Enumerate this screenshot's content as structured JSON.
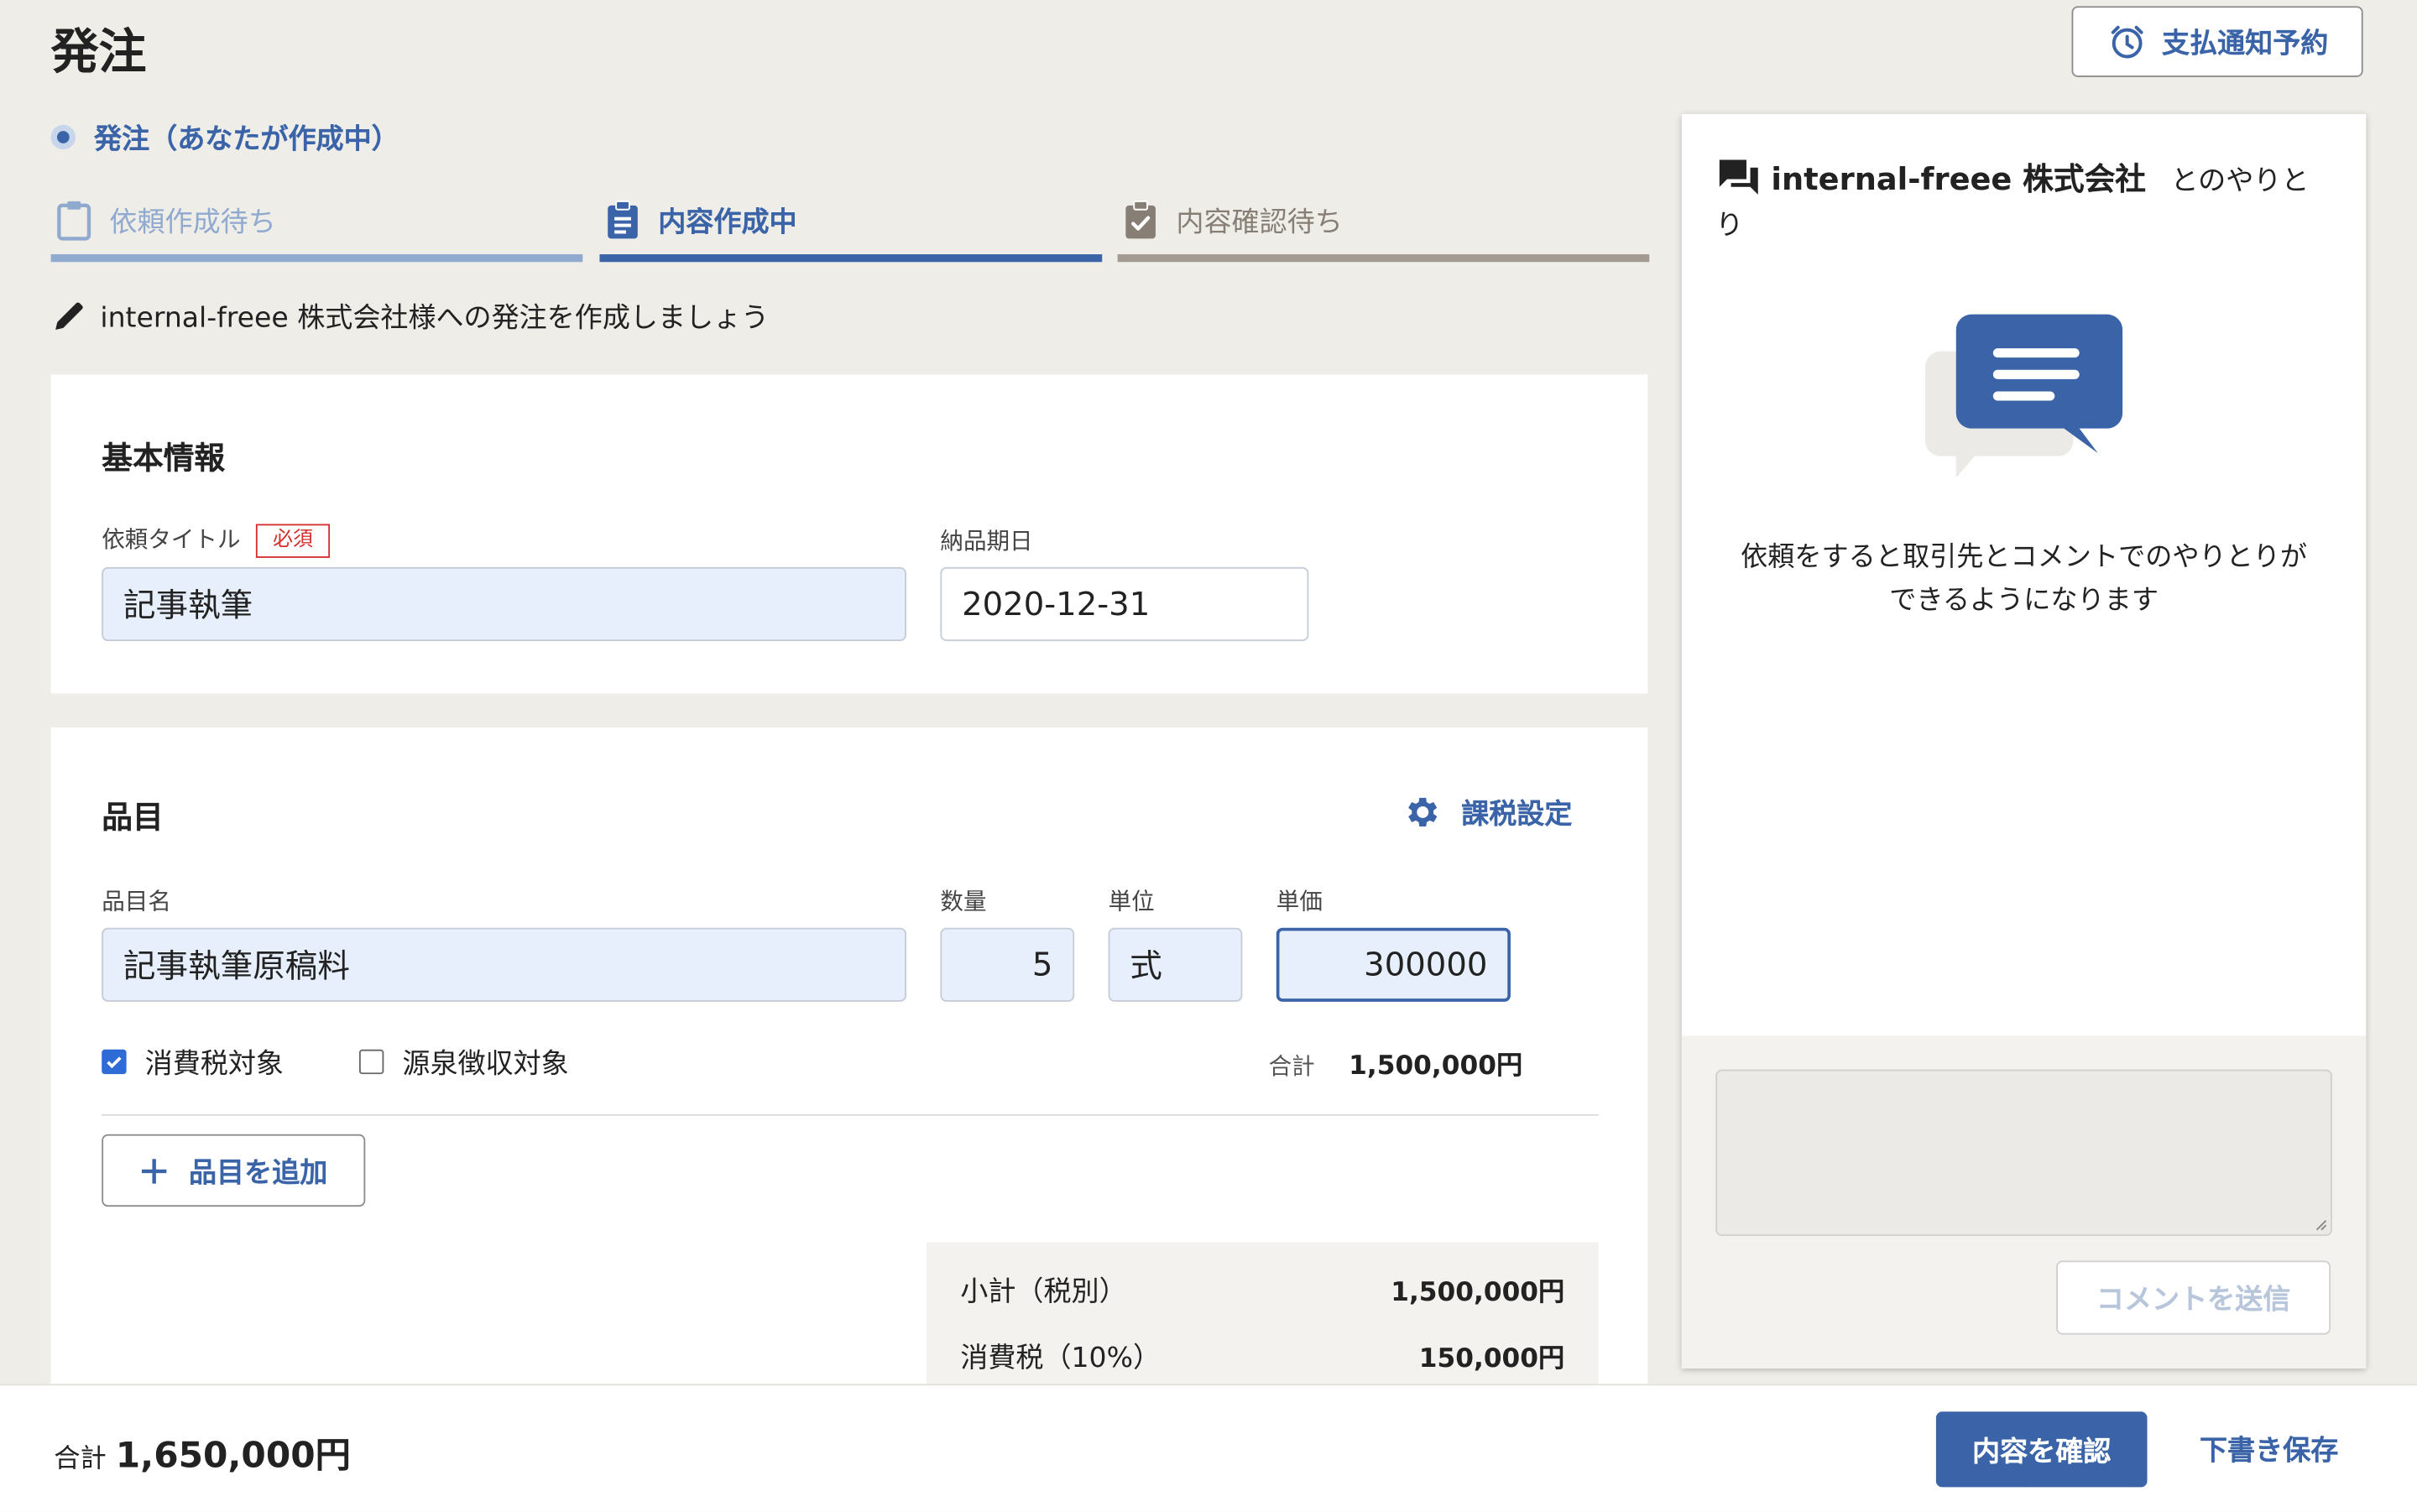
{
  "page": {
    "title": "発注",
    "notify_button": "支払通知予約",
    "status_text": "発注（あなたが作成中）",
    "steps": [
      {
        "label": "依頼作成待ち",
        "state": "done"
      },
      {
        "label": "内容作成中",
        "state": "active"
      },
      {
        "label": "内容確認待ち",
        "state": "pending"
      }
    ],
    "hint": "internal-freee 株式会社様への発注を作成しましょう"
  },
  "basic_info": {
    "section_title": "基本情報",
    "title_label": "依頼タイトル",
    "required_badge": "必須",
    "title_value": "記事執筆",
    "due_label": "納品期日",
    "due_value": "2020-12-31"
  },
  "items": {
    "section_title": "品目",
    "tax_settings": "課税設定",
    "name_label": "品目名",
    "qty_label": "数量",
    "unit_label": "単位",
    "price_label": "単価",
    "row": {
      "name": "記事執筆原稿料",
      "qty": "5",
      "unit": "式",
      "price": "300000",
      "consumption_tax_label": "消費税対象",
      "consumption_tax_checked": true,
      "withholding_label": "源泉徴収対象",
      "withholding_checked": false,
      "total_label": "合計",
      "total_value": "1,500,000円"
    },
    "add_button": "品目を追加",
    "summary": [
      {
        "label": "小計（税別）",
        "value": "1,500,000円"
      },
      {
        "label": "消費税（10%）",
        "value": "150,000円"
      }
    ]
  },
  "chat": {
    "company": "internal-freee 株式会社",
    "suffix": "とのやりとり",
    "empty_message_line1": "依頼をすると取引先とコメントでのやりとりが",
    "empty_message_line2": "できるようになります",
    "textarea_value": "",
    "send_button": "コメントを送信"
  },
  "footer": {
    "total_label": "合計",
    "total_value": "1,650,000円",
    "confirm_button": "内容を確認",
    "draft_button": "下書き保存"
  },
  "colors": {
    "accent": "#3a64a7",
    "background": "#efede8",
    "field_bg": "#e6effb",
    "required": "#d32f2f"
  }
}
